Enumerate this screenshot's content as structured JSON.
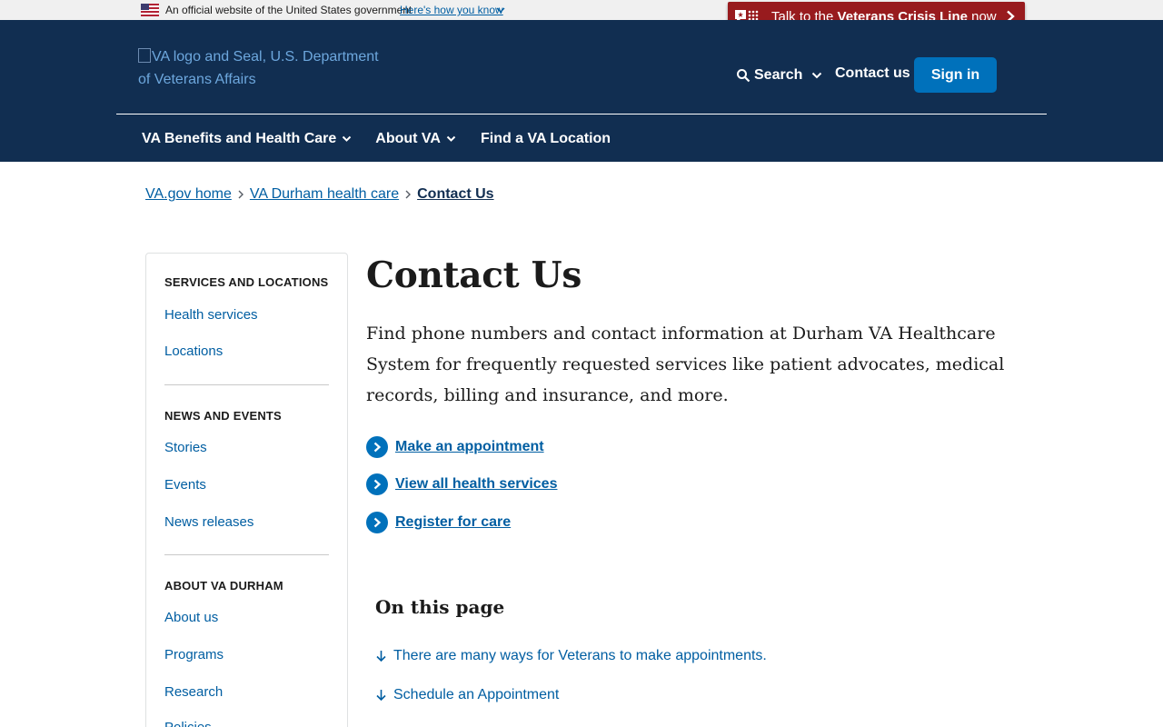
{
  "gov_banner": {
    "official_text": "An official website of the United States government",
    "how_link": "Here's how you know"
  },
  "crisis_line": {
    "prefix": "Talk to the ",
    "bold": "Veterans Crisis Line",
    "suffix": " now"
  },
  "header": {
    "logo_alt": "VA logo and Seal, U.S. Department of Veterans Affairs",
    "search_label": "Search",
    "contact_label": "Contact us",
    "signin_label": "Sign in",
    "nav": [
      {
        "label": "VA Benefits and Health Care"
      },
      {
        "label": "About VA"
      },
      {
        "label": "Find a VA Location"
      }
    ]
  },
  "breadcrumb": [
    "VA.gov home",
    "VA Durham health care",
    "Contact Us"
  ],
  "sidebar": {
    "sections": [
      {
        "title": "SERVICES AND LOCATIONS",
        "items": [
          "Health services",
          "Locations"
        ]
      },
      {
        "title": "NEWS AND EVENTS",
        "items": [
          "Stories",
          "Events",
          "News releases"
        ]
      },
      {
        "title": "ABOUT VA DURHAM",
        "items": [
          "About us",
          "Programs",
          "Research",
          "Policies"
        ]
      }
    ]
  },
  "main": {
    "title": "Contact Us",
    "intro": "Find phone numbers and contact information at Durham VA Healthcare System for frequently requested services like patient advocates, medical records, billing and insurance, and more.",
    "actions": [
      "Make an appointment",
      "View all health services",
      "Register for care"
    ],
    "on_this_page": {
      "title": "On this page",
      "links": [
        "There are many ways for Veterans to make appointments.",
        "Schedule an Appointment"
      ]
    }
  },
  "colors": {
    "header_bg": "#112e51",
    "link": "#005ea2",
    "button": "#0071bb",
    "crisis": "#981b1e"
  }
}
